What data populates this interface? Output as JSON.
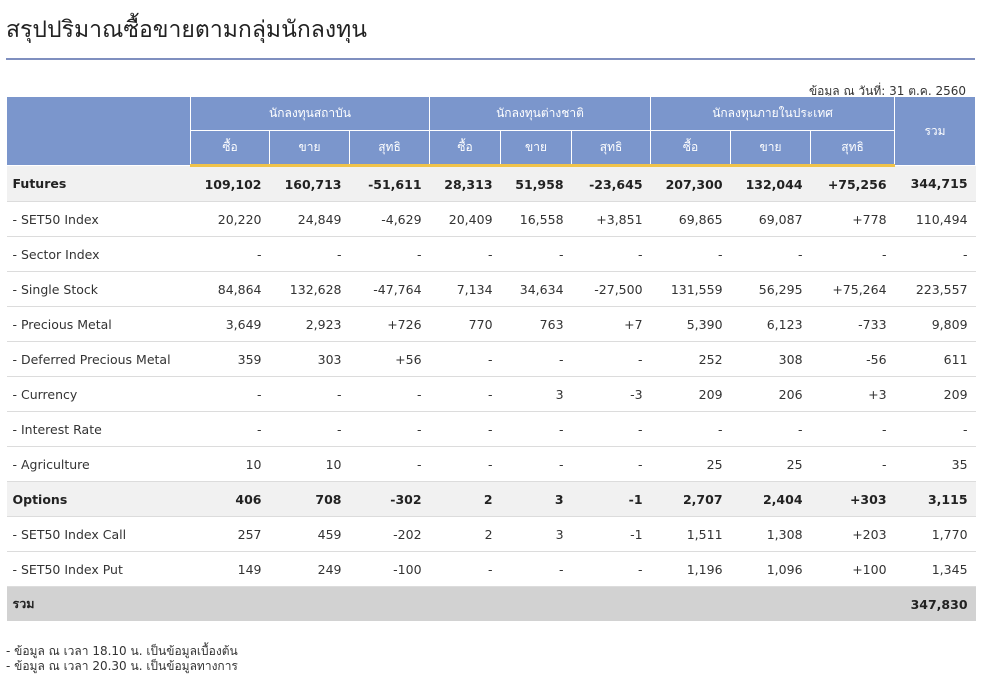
{
  "page": {
    "title": "สรุปปริมาณซื้อขายตามกลุ่มนักลงทุน",
    "as_of": "ข้อมูล ณ วันที่: 31 ต.ค. 2560"
  },
  "table": {
    "groups": [
      "นักลงทุนสถาบัน",
      "นักลงทุนต่างชาติ",
      "นักลงทุนภายในประเทศ"
    ],
    "total_header": "รวม",
    "sub_headers": [
      "ซื้อ",
      "ขาย",
      "สุทธิ"
    ],
    "rows": [
      {
        "label": "Futures",
        "group": true,
        "cells": [
          "109,102",
          "160,713",
          "-51,611",
          "28,313",
          "51,958",
          "-23,645",
          "207,300",
          "132,044",
          "+75,256",
          "344,715"
        ]
      },
      {
        "label": "- SET50 Index",
        "group": false,
        "cells": [
          "20,220",
          "24,849",
          "-4,629",
          "20,409",
          "16,558",
          "+3,851",
          "69,865",
          "69,087",
          "+778",
          "110,494"
        ]
      },
      {
        "label": "- Sector Index",
        "group": false,
        "cells": [
          "-",
          "-",
          "-",
          "-",
          "-",
          "-",
          "-",
          "-",
          "-",
          "-"
        ]
      },
      {
        "label": "- Single Stock",
        "group": false,
        "cells": [
          "84,864",
          "132,628",
          "-47,764",
          "7,134",
          "34,634",
          "-27,500",
          "131,559",
          "56,295",
          "+75,264",
          "223,557"
        ]
      },
      {
        "label": "- Precious Metal",
        "group": false,
        "cells": [
          "3,649",
          "2,923",
          "+726",
          "770",
          "763",
          "+7",
          "5,390",
          "6,123",
          "-733",
          "9,809"
        ]
      },
      {
        "label": "- Deferred Precious Metal",
        "group": false,
        "cells": [
          "359",
          "303",
          "+56",
          "-",
          "-",
          "-",
          "252",
          "308",
          "-56",
          "611"
        ]
      },
      {
        "label": "- Currency",
        "group": false,
        "cells": [
          "-",
          "-",
          "-",
          "-",
          "3",
          "-3",
          "209",
          "206",
          "+3",
          "209"
        ]
      },
      {
        "label": "- Interest Rate",
        "group": false,
        "cells": [
          "-",
          "-",
          "-",
          "-",
          "-",
          "-",
          "-",
          "-",
          "-",
          "-"
        ]
      },
      {
        "label": "- Agriculture",
        "group": false,
        "cells": [
          "10",
          "10",
          "-",
          "-",
          "-",
          "-",
          "25",
          "25",
          "-",
          "35"
        ]
      },
      {
        "label": "Options",
        "group": true,
        "cells": [
          "406",
          "708",
          "-302",
          "2",
          "3",
          "-1",
          "2,707",
          "2,404",
          "+303",
          "3,115"
        ]
      },
      {
        "label": "- SET50 Index Call",
        "group": false,
        "cells": [
          "257",
          "459",
          "-202",
          "2",
          "3",
          "-1",
          "1,511",
          "1,308",
          "+203",
          "1,770"
        ]
      },
      {
        "label": "- SET50 Index Put",
        "group": false,
        "cells": [
          "149",
          "249",
          "-100",
          "-",
          "-",
          "-",
          "1,196",
          "1,096",
          "+100",
          "1,345"
        ]
      }
    ],
    "total": {
      "label": "รวม",
      "value": "347,830"
    }
  },
  "notes": [
    "- ข้อมูล ณ เวลา 18.10 น. เป็นข้อมูลเบื้องต้น",
    "- ข้อมูล ณ เวลา 20.30 น. เป็นข้อมูลทางการ"
  ],
  "colors": {
    "header_bg": "#7b96cc",
    "header_accent": "#f0c34a",
    "negative": "#e1001b",
    "positive": "#1e9d1e"
  }
}
